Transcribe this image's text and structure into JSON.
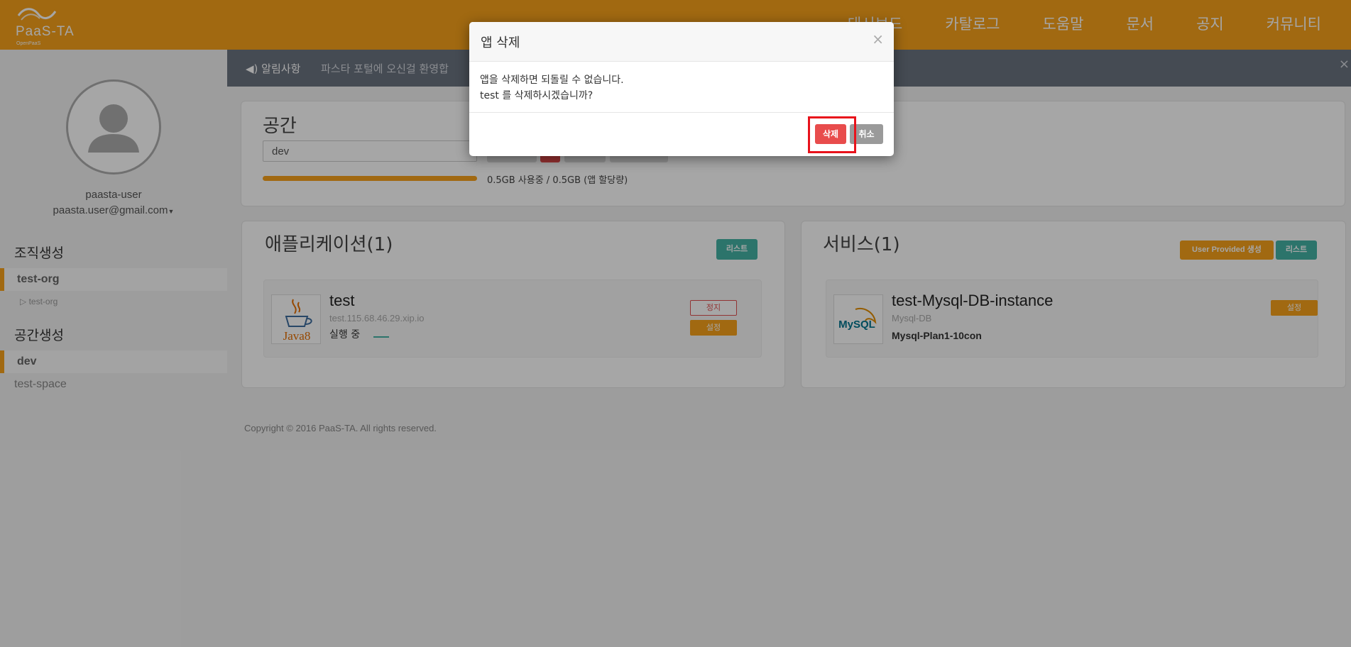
{
  "header": {
    "logo_text": "PaaS-TA",
    "logo_sub": "OpenPaaS",
    "nav": [
      "대시보드",
      "카탈로그",
      "도움말",
      "문서",
      "공지",
      "커뮤니티"
    ]
  },
  "sidebar": {
    "username": "paasta-user",
    "email": "paasta.user@gmail.com",
    "org_header": "조직생성",
    "org_active": "test-org",
    "org_sub": "▷ test-org",
    "space_header": "공간생성",
    "space_active": "dev",
    "space_other": "test-space"
  },
  "notice": {
    "label": "알림사항",
    "message": "파스타 포털에 오신걸 환영합",
    "close": "×"
  },
  "space_panel": {
    "title": "공간",
    "selected_space": "dev",
    "usage_text": "0.5GB 사용중 / 0.5GB (앱 할당량)",
    "usage_fraction": 1.0
  },
  "apps_panel": {
    "title": "애플리케이션(1)",
    "list_button": "리스트",
    "app": {
      "name": "test",
      "url": "test.115.68.46.29.xip.io",
      "status": "실행 중",
      "stop_button": "정지",
      "settings_button": "설정",
      "icon": "java8-logo",
      "icon_text": "Java8"
    }
  },
  "services_panel": {
    "title": "서비스(1)",
    "user_provided_button": "User Provided 생성",
    "list_button": "리스트",
    "service": {
      "name": "test-Mysql-DB-instance",
      "type": "Mysql-DB",
      "plan": "Mysql-Plan1-10con",
      "settings_button": "설정",
      "icon": "mysql-logo",
      "icon_text": "MySQL"
    }
  },
  "footer": {
    "copyright": "Copyright © 2016 PaaS-TA. All rights reserved."
  },
  "modal": {
    "title": "앱 삭제",
    "close": "×",
    "line1": "앱을 삭제하면 되돌릴 수 없습니다.",
    "line2": "test 를 삭제하시겠습니까?",
    "delete_button": "삭제",
    "cancel_button": "취소"
  },
  "colors": {
    "brand": "#f7a21b",
    "teal": "#44b3a5",
    "danger": "#e84c4c",
    "highlight": "#e8121b"
  }
}
